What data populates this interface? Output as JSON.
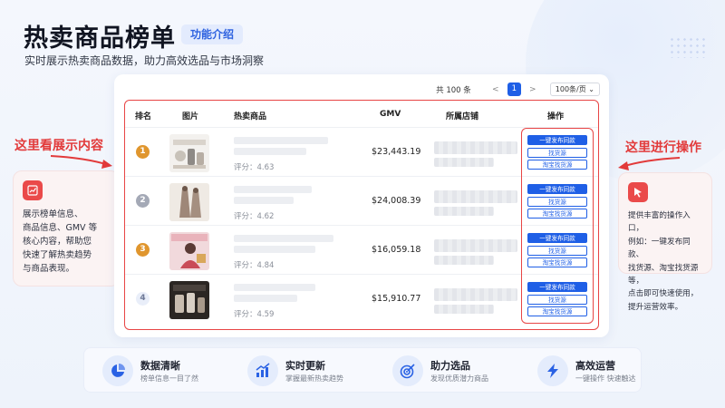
{
  "header": {
    "title": "热卖商品榜单",
    "badge": "功能介绍",
    "subtitle": "实时展示热卖商品数据，助力高效选品与市场洞察"
  },
  "left_callout": {
    "title": "这里看展示内容",
    "icon": "chart-icon",
    "text": "展示榜单信息、\n商品信息、GMV 等\n核心内容，帮助您\n快速了解热卖趋势\n与商品表现。"
  },
  "right_callout": {
    "title": "这里进行操作",
    "icon": "cursor-icon",
    "text": "提供丰富的操作入口，\n例如：一键发布同款、\n找货源、淘宝找货源等，\n点击即可快速使用，\n提升运营效率。"
  },
  "pager": {
    "total": "共 100 条",
    "prev": "<",
    "page": "1",
    "next": ">",
    "page_size": "100条/页"
  },
  "table": {
    "headers": {
      "rank": "排名",
      "image": "图片",
      "product": "热卖商品",
      "gmv": "GMV",
      "shop": "所属店铺",
      "ops": "操作"
    },
    "rows": [
      {
        "rank": "1",
        "score": "评分：4.63",
        "gmv": "$23,443.19",
        "rank_color": "#e0962e"
      },
      {
        "rank": "2",
        "score": "评分：4.62",
        "gmv": "$24,008.39",
        "rank_color": "#a4a9b6"
      },
      {
        "rank": "3",
        "score": "评分：4.84",
        "gmv": "$16,059.18",
        "rank_color": "#e0962e"
      },
      {
        "rank": "4",
        "score": "评分：4.59",
        "gmv": "$15,910.77",
        "rank_color": "#dfe6f5"
      }
    ],
    "ops": {
      "publish_same": "一键发布同款",
      "find_source": "找货源",
      "taobao_source": "淘宝找货源"
    }
  },
  "features": [
    {
      "title": "数据清晰",
      "desc": "榜单信息一目了然",
      "icon": "pie-chart-icon"
    },
    {
      "title": "实时更新",
      "desc": "掌握最新热卖趋势",
      "icon": "trend-chart-icon"
    },
    {
      "title": "助力选品",
      "desc": "发现优质潜力商品",
      "icon": "target-icon"
    },
    {
      "title": "高效运营",
      "desc": "一键操作 快速触达",
      "icon": "lightning-icon"
    }
  ],
  "colors": {
    "accent": "#1f5fe6",
    "highlight": "#e84545"
  }
}
